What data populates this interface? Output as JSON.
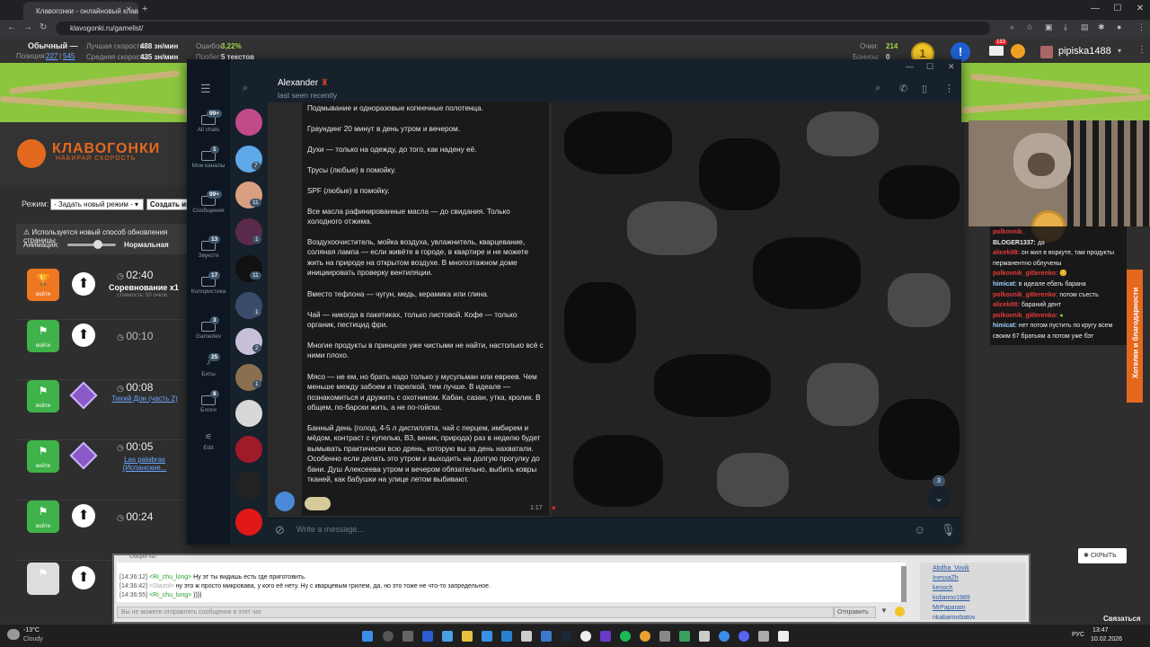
{
  "browser": {
    "tab_title": "Клавогонки - онлайновый клавиатурный тренажер",
    "url": "klavogonki.ru/gamelist/"
  },
  "site": {
    "stats": {
      "rank": "Обычный —",
      "position_label": "Позиция:",
      "position_value": "227",
      "position_total": "545",
      "best_speed_label": "Лучшая скорость:",
      "best_speed": "488 зн/мин",
      "avg_speed_label": "Средняя скорость:",
      "avg_speed": "435 зн/мин",
      "errors_label": "Ошибок:",
      "errors": "3,22%",
      "mileage_label": "Пробег:",
      "mileage": "5 текстов",
      "points_label": "Очки:",
      "points": "214",
      "bonuses_label": "Бонусы:",
      "bonuses": "0"
    },
    "logo_title": "КЛАВОГОНКИ",
    "logo_subtitle": "НАБИРАЙ СКОРОСТЬ",
    "mode_label": "Режим:",
    "mode_value": "- Задать новый режим -",
    "create_label": "Создать игру",
    "notice": "Используется новый способ обновления страницы",
    "animation_label": "Анимация:",
    "animation_value": "Нормальная",
    "join_label": "войти",
    "games": [
      {
        "timer": "02:40",
        "title": "Соревнование x1",
        "cost": "стоимость: 50 очков",
        "sub": ""
      },
      {
        "timer": "00:10",
        "title": "",
        "cost": "",
        "sub": ""
      },
      {
        "timer": "00:08",
        "title": "",
        "cost": "",
        "sub": "Тихий Дон (часть 2)"
      },
      {
        "timer": "00:05",
        "title": "",
        "cost": "",
        "sub": "Las palabras (Испанские..."
      },
      {
        "timer": "00:24",
        "title": "",
        "cost": "",
        "sub": ""
      }
    ],
    "username": "pipiska1488",
    "mail_count": "183",
    "side_tab": "Хотелки и благодарности",
    "hide_button": "СКРЫТЬ",
    "connect": "Связаться"
  },
  "stream_chat": [
    {
      "name": "polkovnik_",
      "text": "",
      "color": "#e83a3a"
    },
    {
      "name": "BLOGER1337:",
      "text": "да",
      "color": "#ffffff"
    },
    {
      "name": "alicekit8:",
      "text": "он жил в воркуте, там продукты",
      "color": "#e83a3a"
    },
    {
      "name": "",
      "text": "перманентно облучены",
      "color": "#ffffff"
    },
    {
      "name": "polkovnik_gitlerenko:",
      "text": "",
      "color": "#e83a3a"
    },
    {
      "name": "himicat:",
      "text": "в идеале ебать барана",
      "color": "#9ad0ff"
    },
    {
      "name": "polkovnik_gitlerenko:",
      "text": "потом съесть",
      "color": "#e83a3a"
    },
    {
      "name": "alicekit8:",
      "text": "бараний дент",
      "color": "#e83a3a"
    },
    {
      "name": "polkovnik_gitlerenko:",
      "text": "",
      "color": "#e83a3a"
    },
    {
      "name": "himicat:",
      "text": "нет потом пустить по кругу всем",
      "color": "#9ad0ff"
    },
    {
      "name": "",
      "text": "своим 67 братьям а потом уже бэт",
      "color": "#ffffff"
    }
  ],
  "telegram": {
    "contact_name": "Alexander",
    "contact_status": "last seen recently",
    "input_placeholder": "Write a message...",
    "message_time": "1:17",
    "scroll_badge": "3",
    "folders": [
      {
        "label": "All chats",
        "badge": "99+"
      },
      {
        "label": "Мои каналы",
        "badge": "1"
      },
      {
        "label": "Сообщения",
        "badge": "99+"
      },
      {
        "label": "Звукотк",
        "badge": "13"
      },
      {
        "label": "Колористика",
        "badge": "17"
      },
      {
        "label": "Gamedev",
        "badge": "3"
      },
      {
        "label": "Биты",
        "badge": "25"
      },
      {
        "label": "Блоги",
        "badge": "8"
      },
      {
        "label": "Edit",
        "badge": ""
      }
    ],
    "chat_badges": [
      "",
      "7",
      "11",
      "1",
      "11",
      "1",
      "2",
      "1",
      "",
      "",
      "",
      ""
    ],
    "message_paragraphs": [
      "Подмывание и одноразовые копеечные полотенца.",
      "Граундинг 20 минут в день утром и вечером.",
      "Духи — только на одежду, до того, как надену её.",
      "Трусы (любые) в помойку.",
      "SPF (любые) в помойку.",
      "Все масла рафинированные масла — до свидания. Только холодного отжима.",
      "Воздухоочиститель, мойка воздуха, увлажнитель, кварцевание, соляная лампа — если живёте в городе, в квартире и не можете жить на природе на открытом воздухе. В многоэтажном доме инициировать проверку вентиляции.",
      "Вместо тефлона — чугун, медь, керамика или глина.",
      "Чай — никогда в пакетиках, только листовой. Кофе — только органик, пестицид фри.",
      "Многие продукты в принципе уже чистыми не найти, настолько всё с ними плохо.",
      "Мясо — не ем, но брать надо только у мусульман или евреев. Чем меньше между забоем и тарелкой, тем лучше. В идеале — познакомиться и дружить с охотником. Кабан, сазан, утка, кролик. В общем, по-барски жить, а не по-гойски.",
      "Банный день (голод, 4-5 л дистиллята, чай с перцем, имбирем и мёдом, контраст с купелью, ВЗ, веник, природа) раз в неделю будет вымывать практически всю дрянь, которую вы за день нахватали. Особенно если делать это утром и выходить на долгую прогулку до бани. Душ Алексеева утром и вечером обязательно, выбить ковры тканей, как бабушки на улице летом выбивают."
    ]
  },
  "general_chat": {
    "title": "Общий чат",
    "messages": [
      {
        "time": "[14:36:12]",
        "user": "<Ri_chu_long>",
        "text": "Ну эт ты видишь есть где приготовить."
      },
      {
        "time": "[14:36:42]",
        "user": "<Stazol>",
        "text": "ну это ж просто микровава, у кого её нету. Ну с кварцевым грилем, да, но это тоже не что-то запредельное."
      },
      {
        "time": "[14:36:55]",
        "user": "<Ri_chu_long>",
        "text": "))))"
      }
    ],
    "users": [
      "Abdha_Vovik",
      "InessaZh",
      "kenoch",
      "kolianno1989",
      "MrPaparam",
      "nkabarovibatov"
    ],
    "input_placeholder": "Вы не можете отправлять сообщения в этот чат",
    "send_label": "Отправить"
  },
  "taskbar": {
    "temp": "-13°C",
    "weather": "Cloudy",
    "lang": "РУС",
    "time": "13:47",
    "date": "10.02.2026"
  },
  "colors": {
    "brand_orange": "#e4691f",
    "join_green": "#3fb349",
    "telegram_bg": "#17212b"
  }
}
